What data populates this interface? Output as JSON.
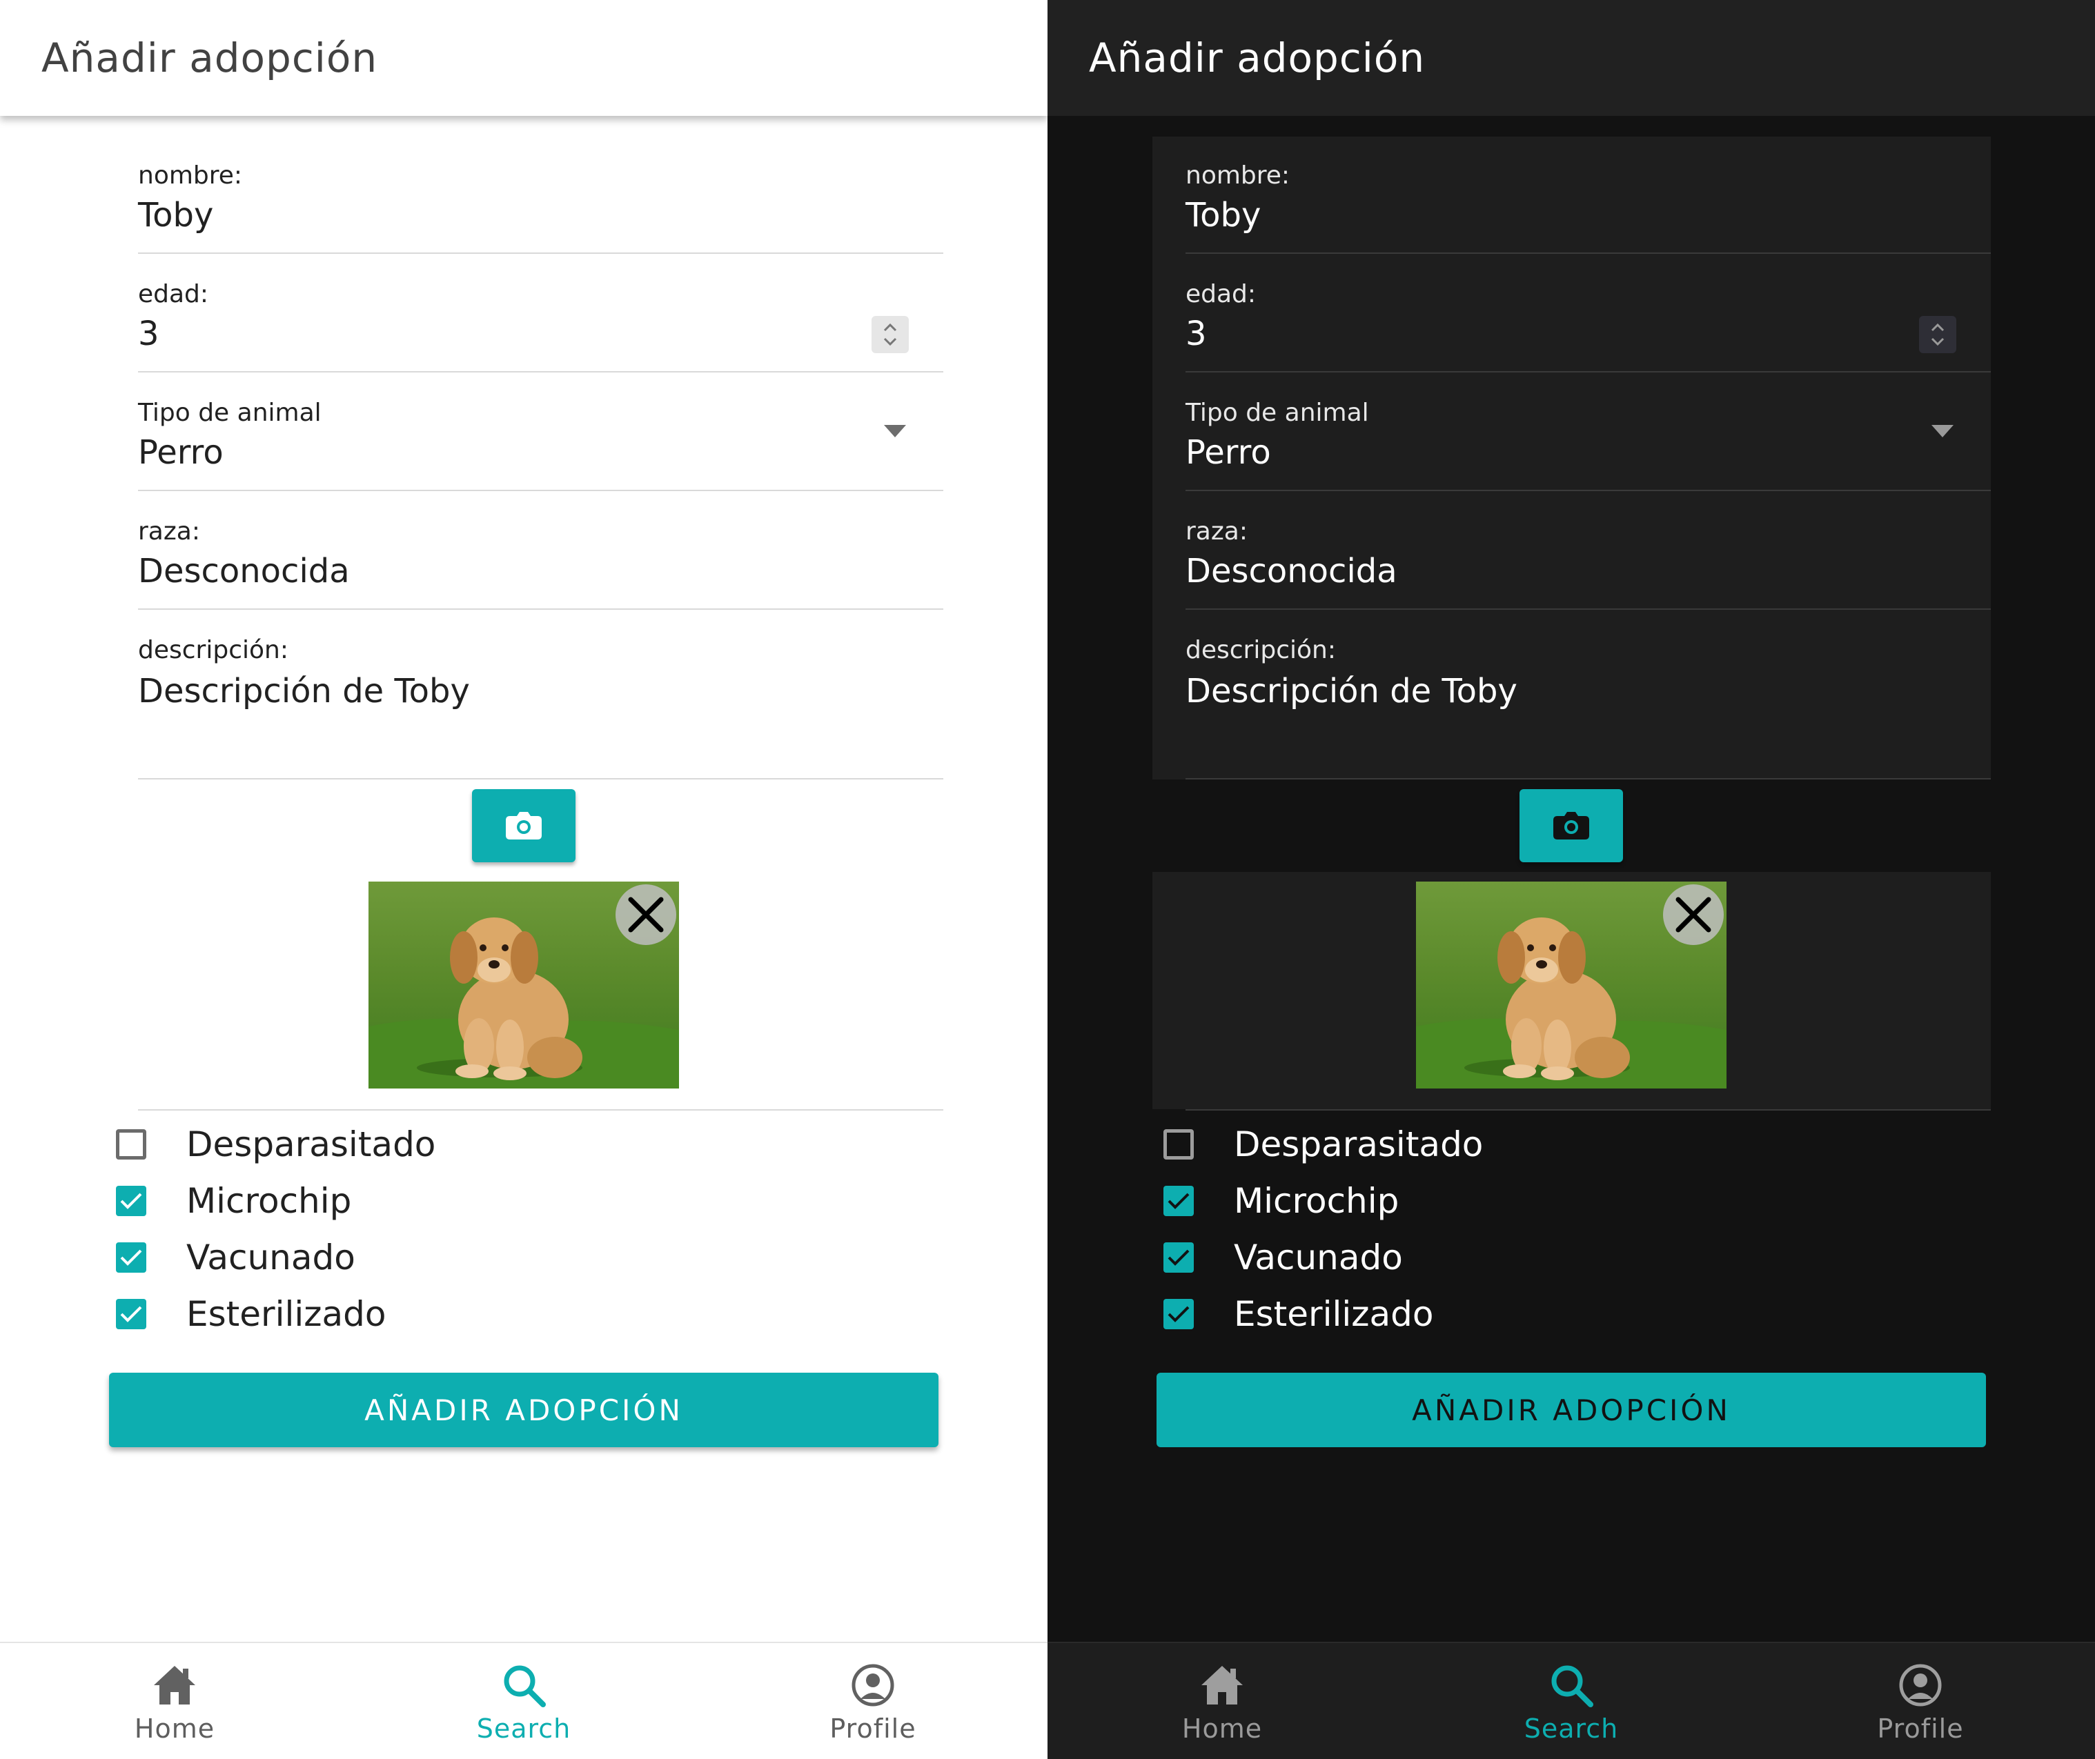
{
  "app": {
    "title": "Añadir adopción",
    "accent_color": "#0daeb0"
  },
  "form": {
    "nombre": {
      "label": "nombre:",
      "value": "Toby"
    },
    "edad": {
      "label": "edad:",
      "value": "3"
    },
    "tipo_animal": {
      "label": "Tipo de animal",
      "value": "Perro"
    },
    "raza": {
      "label": "raza:",
      "value": "Desconocida"
    },
    "descripcion": {
      "label": "descripción:",
      "value": "Descripción de Toby"
    }
  },
  "photo": {
    "camera_icon": "camera-icon",
    "remove_icon": "close-icon"
  },
  "checks": [
    {
      "label": "Desparasitado",
      "checked": false
    },
    {
      "label": "Microchip",
      "checked": true
    },
    {
      "label": "Vacunado",
      "checked": true
    },
    {
      "label": "Esterilizado",
      "checked": true
    }
  ],
  "submit_label": "AÑADIR ADOPCIÓN",
  "nav": [
    {
      "label": "Home",
      "icon": "home-icon",
      "active": false
    },
    {
      "label": "Search",
      "icon": "search-icon",
      "active": true
    },
    {
      "label": "Profile",
      "icon": "profile-icon",
      "active": false
    }
  ],
  "themes": {
    "light": {
      "background": "#ffffff"
    },
    "dark": {
      "background": "#121212"
    }
  }
}
